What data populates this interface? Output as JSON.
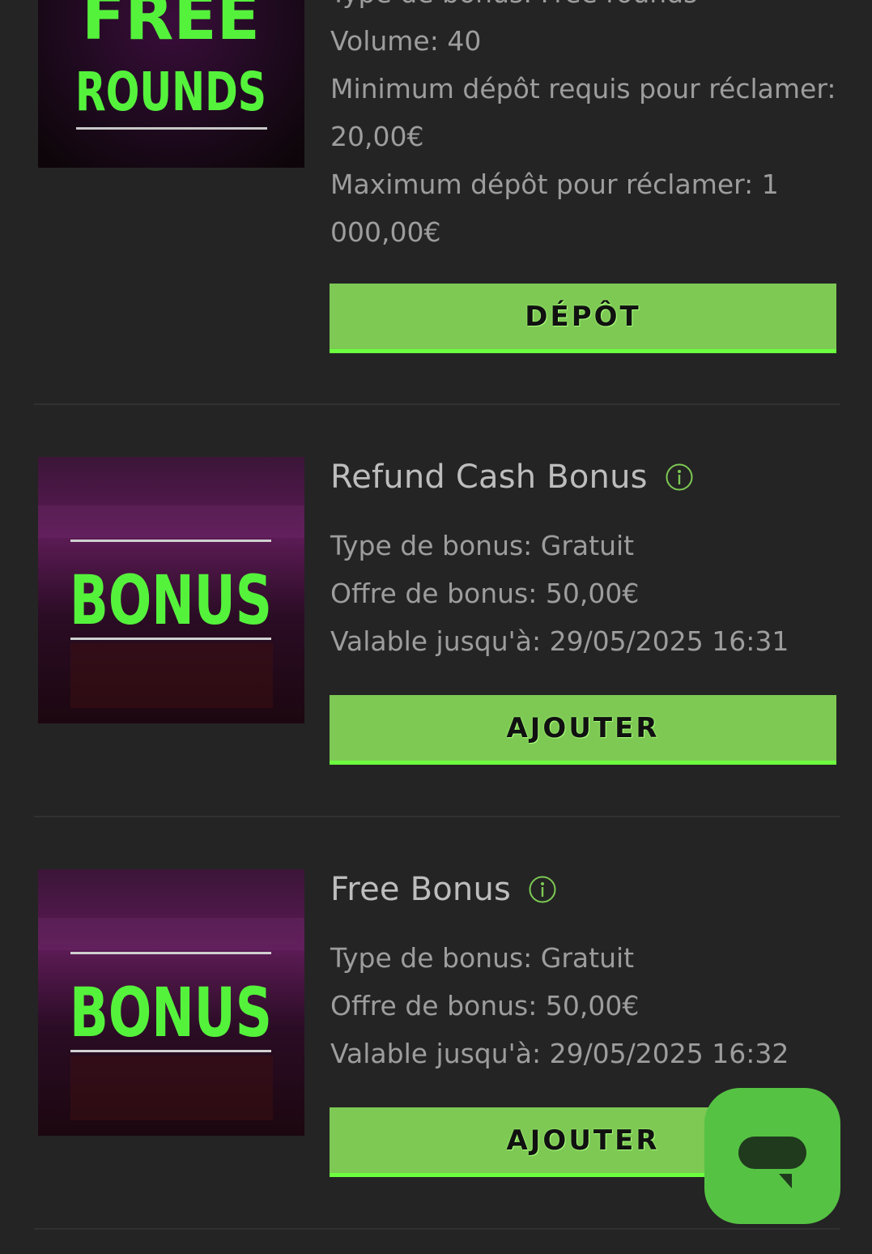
{
  "offers": [
    {
      "image_text_top": "FREE",
      "image_text_bottom": "ROUNDS",
      "partial_line": "Type de bonus: Free rounds",
      "details": [
        "Volume: 40",
        "Minimum dépôt requis pour réclamer:",
        "20,00€",
        "Maximum dépôt pour réclamer: 1",
        "000,00€"
      ],
      "button_label": "DÉPÔT"
    },
    {
      "title": "Refund Cash Bonus",
      "image_text": "BONUS",
      "details": [
        "Type de bonus: Gratuit",
        "Offre de bonus: 50,00€",
        "Valable jusqu'à: 29/05/2025 16:31"
      ],
      "button_label": "AJOUTER"
    },
    {
      "title": "Free Bonus",
      "image_text": "BONUS",
      "details": [
        "Type de bonus: Gratuit",
        "Offre de bonus: 50,00€",
        "Valable jusqu'à: 29/05/2025 16:32"
      ],
      "button_label": "AJOUTER"
    }
  ],
  "colors": {
    "background": "#242424",
    "accent_green": "#7dc954",
    "neon_green": "#55f23c",
    "chat_green": "#56c244"
  },
  "icons": {
    "info": "info-circle-icon",
    "chat": "chat-bubble-icon"
  }
}
